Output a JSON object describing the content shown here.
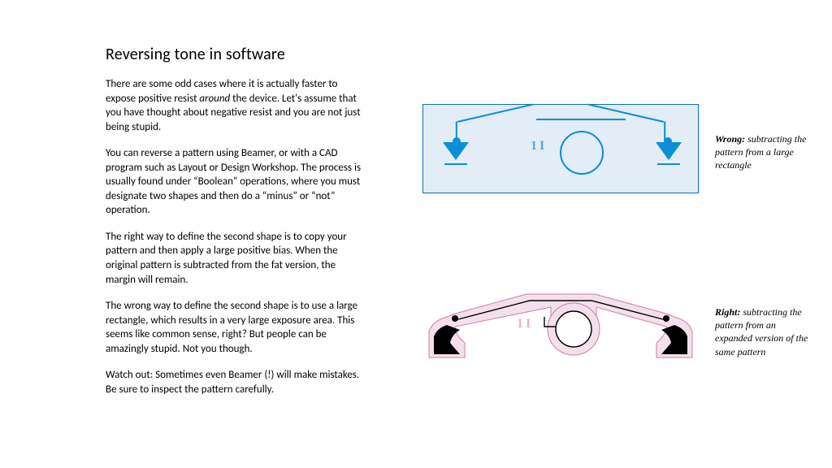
{
  "title": "Reversing tone in software",
  "paragraphs": {
    "p1a": "There are some odd cases where it is actually faster to expose positive resist ",
    "p1em": "around",
    "p1b": " the device. Let's assume that you have thought about negative resist and you are not just being stupid.",
    "p2": "You can reverse a pattern using Beamer, or with a CAD program such as Layout or Design Workshop. The process is usually found under “Boolean” operations, where you must designate two shapes and then do a “minus” or “not” operation.",
    "p3": "The right way to define the second shape is to copy your pattern and then apply a large positive bias. When the original pattern is subtracted from the fat version, the margin will remain.",
    "p4": "The wrong way to define the second shape is to use a large rectangle, which results in a very large exposure area. This seems like common sense, right? But people can be amazingly stupid. Not you though.",
    "p5": "Watch out: Sometimes even Beamer (!) will make mistakes. Be sure to inspect the pattern carefully."
  },
  "captions": {
    "wrong_bold": "Wrong:",
    "wrong_rest": " subtracting the pattern from a large rectangle",
    "right_bold": "Right:",
    "right_rest": " subtracting the pattern from an expanded version of the same pattern"
  },
  "fig_label": "1I"
}
